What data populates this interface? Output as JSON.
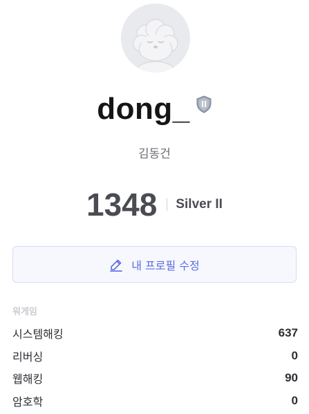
{
  "profile": {
    "avatar_icon": "default-sheep-avatar",
    "username": "dong_",
    "tier_icon": "silver-shield-icon",
    "real_name": "김동건",
    "rating": "1348",
    "tier_name": "Silver II"
  },
  "edit_button": {
    "label": "내 프로필 수정",
    "icon": "pencil-icon"
  },
  "stats_section": {
    "title": "워게임",
    "rows": [
      {
        "label": "시스템해킹",
        "value": "637"
      },
      {
        "label": "리버싱",
        "value": "0"
      },
      {
        "label": "웹해킹",
        "value": "90"
      },
      {
        "label": "암호학",
        "value": "0"
      }
    ]
  },
  "colors": {
    "accent": "#5b6be0",
    "button_bg": "#f7f8fe",
    "button_border": "#d6dbf3",
    "avatar_bg": "#e9eaee",
    "muted_text": "#6b6e75"
  }
}
